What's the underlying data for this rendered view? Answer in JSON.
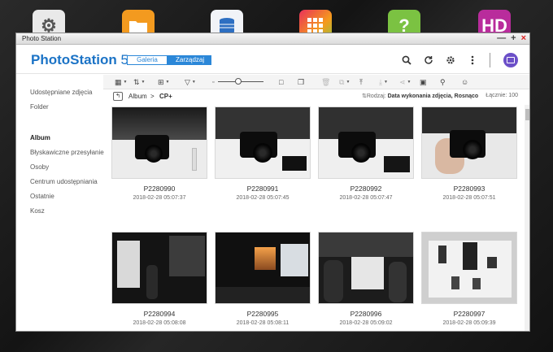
{
  "desktop": {
    "apps": [
      {
        "name": "settings",
        "glyph": "⚙"
      },
      {
        "name": "file-station",
        "glyph": "▬"
      },
      {
        "name": "backup",
        "glyph": "≡"
      },
      {
        "name": "app-center",
        "glyph": "▦"
      },
      {
        "name": "help",
        "glyph": "?"
      },
      {
        "name": "hd-station",
        "glyph": "HD"
      }
    ]
  },
  "window": {
    "title": "Photo Station",
    "controls": {
      "minimize": "—",
      "maximize": "+",
      "close": "×"
    }
  },
  "header": {
    "logo_main": "PhotoStation",
    "logo_version": " 5",
    "tabs": {
      "gallery": "Galeria",
      "manage": "Zarządzaj"
    },
    "icons": [
      "search-icon",
      "refresh-icon",
      "settings-icon",
      "more-icon",
      "cast-icon"
    ]
  },
  "sidebar": {
    "items": [
      {
        "label": "Udostępniane zdjęcia",
        "active": false
      },
      {
        "label": "Folder",
        "active": false
      },
      {
        "label": "Album",
        "active": true
      },
      {
        "label": "Błyskawiczne przesyłanie",
        "active": false
      },
      {
        "label": "Osoby",
        "active": false
      },
      {
        "label": "Centrum udostępniania",
        "active": false
      },
      {
        "label": "Ostatnie",
        "active": false
      },
      {
        "label": "Kosz",
        "active": false
      }
    ]
  },
  "toolbar": {
    "glyphs": {
      "view": "▦",
      "sort": "⇅",
      "add": "⊞",
      "filter": "▽",
      "small": "▫",
      "large": "□",
      "slideshow": "❐",
      "delete": "🗑",
      "copy": "⧉",
      "upload": "⤒",
      "download": "⤓",
      "share": "⋖",
      "qr": "▣",
      "location": "⚲",
      "face": "☺"
    }
  },
  "path": {
    "back": "↰",
    "album": "Album",
    "separator": ">",
    "current": "CP+",
    "sort_prefix": "Rodzaj:",
    "sort_value": "Data wykonania zdjęcia, Rosnąco",
    "total_label": "Łącznie: 100"
  },
  "photos": [
    {
      "name": "P2280990",
      "date": "2018-02-28 05:07:37"
    },
    {
      "name": "P2280991",
      "date": "2018-02-28 05:07:45"
    },
    {
      "name": "P2280992",
      "date": "2018-02-28 05:07:47"
    },
    {
      "name": "P2280993",
      "date": "2018-02-28 05:07:51"
    },
    {
      "name": "P2280994",
      "date": "2018-02-28 05:08:08"
    },
    {
      "name": "P2280995",
      "date": "2018-02-28 05:08:11"
    },
    {
      "name": "P2280996",
      "date": "2018-02-28 05:09:02"
    },
    {
      "name": "P2280997",
      "date": "2018-02-28 05:09:39"
    }
  ]
}
